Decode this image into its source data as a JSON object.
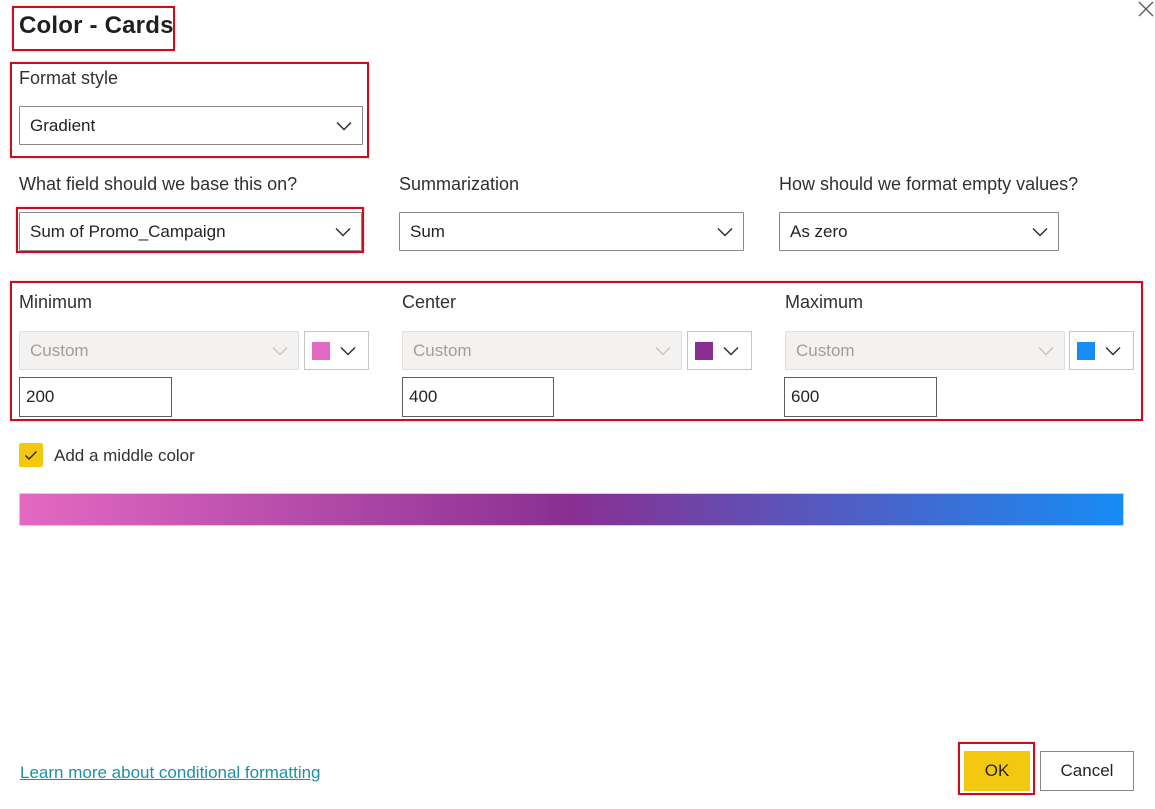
{
  "dialog": {
    "title": "Color - Cards"
  },
  "format_style": {
    "label": "Format style",
    "value": "Gradient"
  },
  "field": {
    "label": "What field should we base this on?",
    "value": "Sum of Promo_Campaign"
  },
  "summarization": {
    "label": "Summarization",
    "value": "Sum"
  },
  "empty_values": {
    "label": "How should we format empty values?",
    "value": "As zero"
  },
  "stops": [
    {
      "label": "Minimum",
      "type": "Custom",
      "color": "#e369c2",
      "value": "200"
    },
    {
      "label": "Center",
      "type": "Custom",
      "color": "#892f92",
      "value": "400"
    },
    {
      "label": "Maximum",
      "type": "Custom",
      "color": "#168cf5",
      "value": "600"
    }
  ],
  "middle_color": {
    "label": "Add a middle color",
    "checked": true
  },
  "footer": {
    "link": "Learn more about conditional formatting",
    "ok": "OK",
    "cancel": "Cancel"
  },
  "colors": {
    "highlight": "#c50f1f",
    "accent": "#f2c811"
  },
  "icons": [
    "close-icon",
    "chevron-down-icon",
    "checkmark-icon"
  ]
}
